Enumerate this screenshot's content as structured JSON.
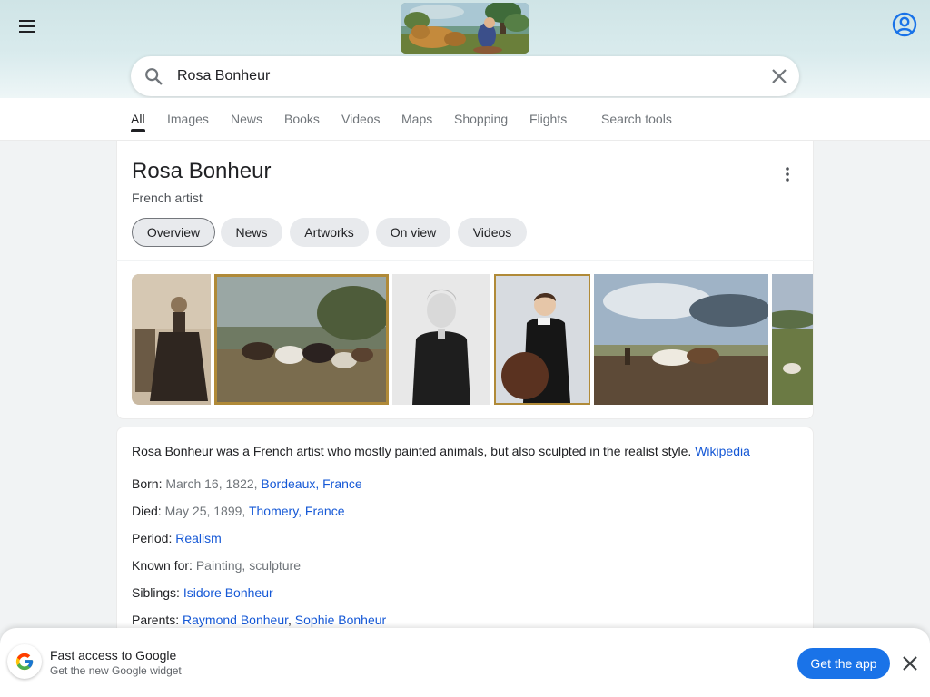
{
  "search": {
    "query": "Rosa Bonheur"
  },
  "tabs": [
    {
      "label": "All",
      "active": true
    },
    {
      "label": "Images"
    },
    {
      "label": "News"
    },
    {
      "label": "Books"
    },
    {
      "label": "Videos"
    },
    {
      "label": "Maps"
    },
    {
      "label": "Shopping"
    },
    {
      "label": "Flights"
    }
  ],
  "search_tools_label": "Search tools",
  "knowledge_panel": {
    "title": "Rosa Bonheur",
    "subtitle": "French artist",
    "chips": [
      "Overview",
      "News",
      "Artworks",
      "On view",
      "Videos"
    ],
    "description": "Rosa Bonheur was a French artist who mostly painted animals, but also sculpted in the realist style.",
    "source_link": "Wikipedia",
    "facts": {
      "born": {
        "label": "Born:",
        "value": "March 16, 1822,",
        "link": "Bordeaux, France"
      },
      "died": {
        "label": "Died:",
        "value": "May 25, 1899,",
        "link": "Thomery, France"
      },
      "period": {
        "label": "Period:",
        "link": "Realism"
      },
      "known_for": {
        "label": "Known for:",
        "value": "Painting, sculpture"
      },
      "siblings": {
        "label": "Siblings:",
        "link": "Isidore Bonheur"
      },
      "parents": {
        "label": "Parents:",
        "link1": "Raymond Bonheur",
        "separator": ",",
        "link2": "Sophie Bonheur"
      }
    }
  },
  "banner": {
    "title": "Fast access to Google",
    "subtitle": "Get the new Google widget",
    "button": "Get the app"
  },
  "colors": {
    "link": "#1558d6",
    "accent_button": "#1a73e8",
    "header_band": "#cfe4e6"
  },
  "icons": [
    "hamburger-menu-icon",
    "account-circle-icon",
    "search-icon",
    "clear-icon",
    "more-vert-icon",
    "google-g-icon",
    "close-icon"
  ]
}
